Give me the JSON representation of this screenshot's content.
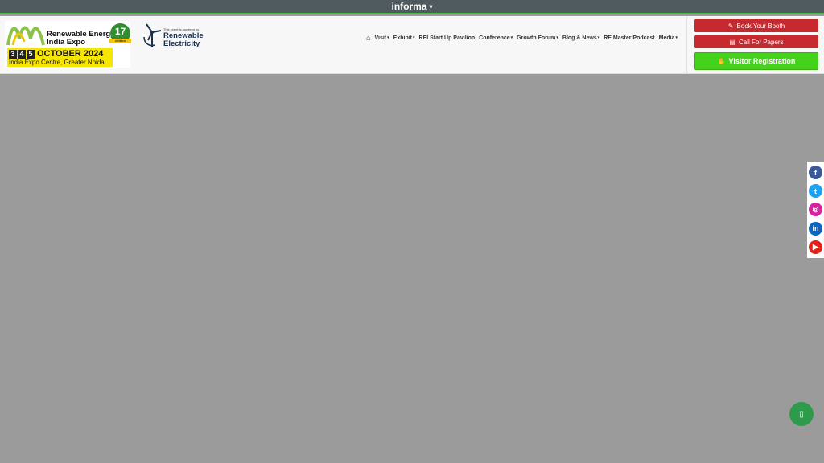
{
  "topbar": {
    "brand": "informa",
    "caret": "▾"
  },
  "logo": {
    "title_line1": "Renewable Energy",
    "title_line2": "India Expo",
    "edition": "17",
    "edition_label": "edition",
    "days": [
      "3",
      "4",
      "5"
    ],
    "month": "OCTOBER 2024",
    "venue": "India Expo Centre, Greater Noida"
  },
  "partner": {
    "tagline": "This event is powered by",
    "brand_line1": "Renewable",
    "brand_line2": "Electricity"
  },
  "nav": {
    "home_icon": "⌂",
    "items": [
      {
        "label": "Visit",
        "caret": "▾"
      },
      {
        "label": "Exhibit",
        "caret": "▾"
      },
      {
        "label": "REI Start Up Pavilion",
        "caret": ""
      },
      {
        "label": "Conference",
        "caret": "▾"
      },
      {
        "label": "Growth Forum",
        "caret": "▾"
      },
      {
        "label": "Blog & News",
        "caret": "▾"
      },
      {
        "label": "RE Master Podcast",
        "caret": ""
      },
      {
        "label": "Media",
        "caret": "▾"
      }
    ]
  },
  "actions": {
    "book_booth": "Book Your Booth",
    "book_booth_icon": "✎",
    "call_papers": "Call For Papers",
    "call_papers_icon": "▤",
    "visitor_registration": "Visitor Registration",
    "visitor_icon": "✋"
  },
  "social": {
    "facebook": "f",
    "twitter": "t",
    "instagram": "◎",
    "linkedin": "in",
    "youtube": "▶"
  },
  "whatsapp_icon": "▯",
  "colors": {
    "topbar": "#4f5a5e",
    "accent_green": "#44d21a",
    "button_red": "#c62a2f",
    "overlay": "#9b9b9b"
  }
}
